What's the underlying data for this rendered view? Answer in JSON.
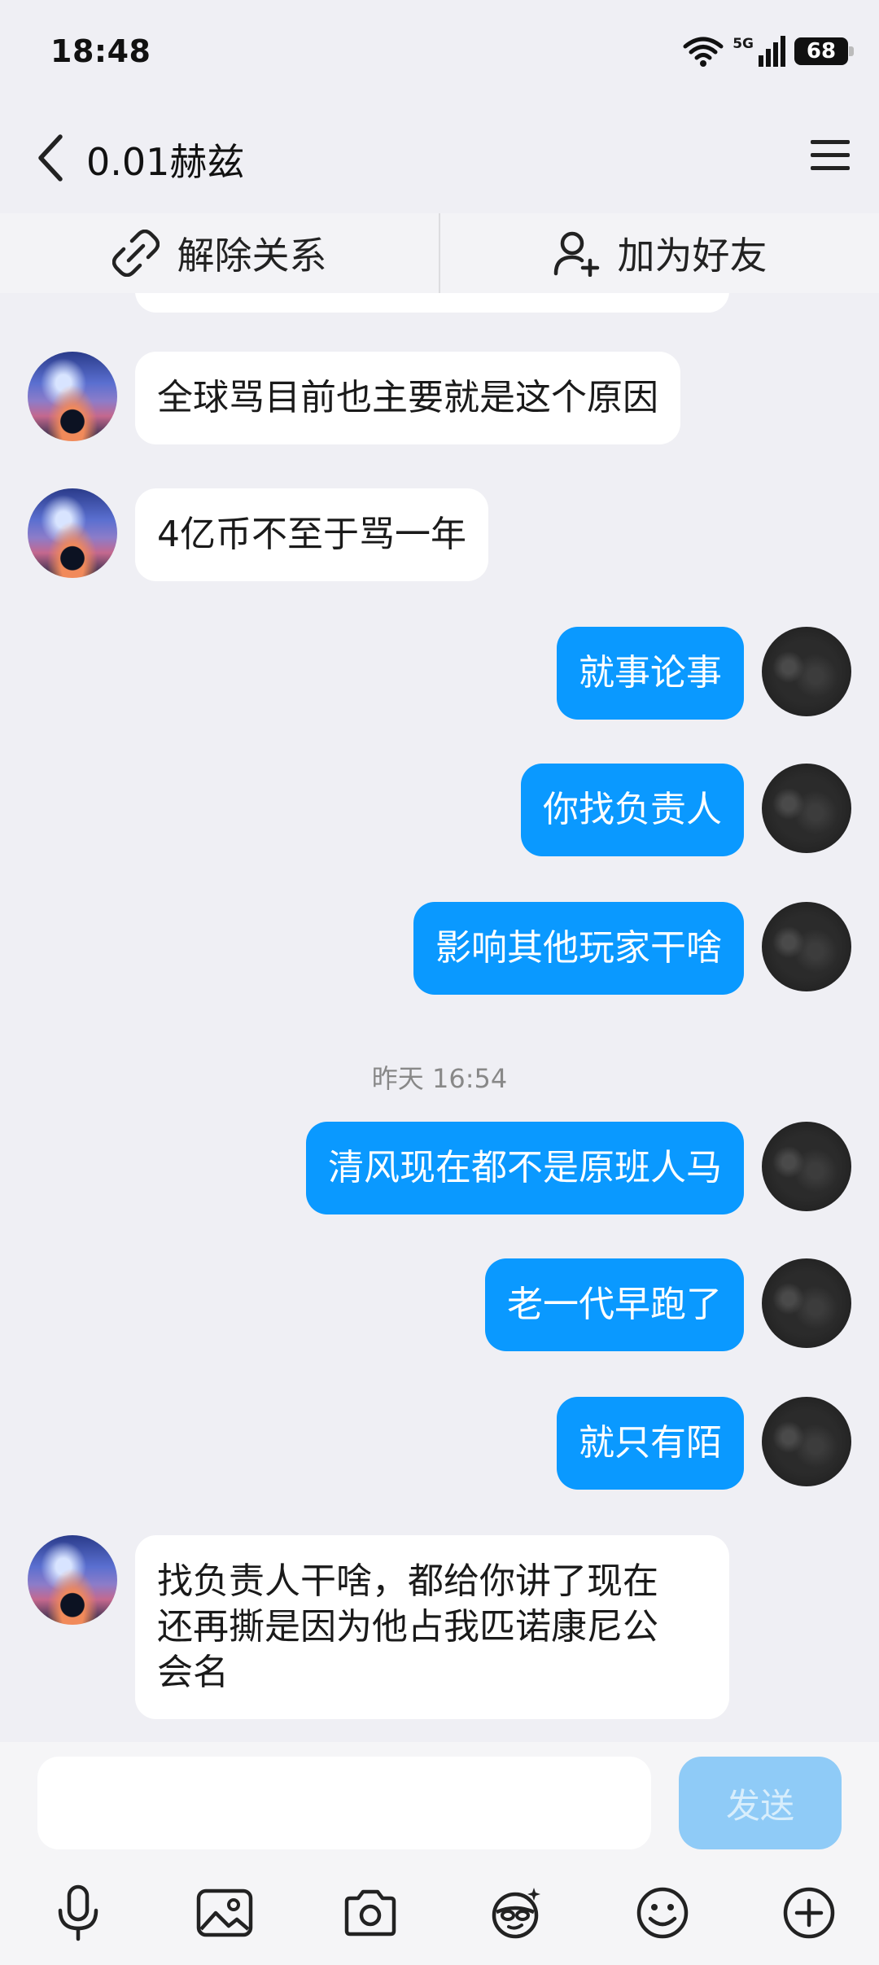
{
  "status_bar": {
    "time": "18:48",
    "network": "5G",
    "battery": "68",
    "battery_level": 68
  },
  "header": {
    "title": "0.01赫兹"
  },
  "actions": {
    "unbind_label": "解除关系",
    "add_friend_label": "加为好友"
  },
  "messages": [
    {
      "side": "them",
      "text": "全球骂目前也主要就是这个原因"
    },
    {
      "side": "them",
      "text": "4亿币不至于骂一年"
    },
    {
      "side": "me",
      "text": "就事论事"
    },
    {
      "side": "me",
      "text": "你找负责人"
    },
    {
      "side": "me",
      "text": "影响其他玩家干啥"
    },
    {
      "side": "me",
      "text": "清风现在都不是原班人马"
    },
    {
      "side": "me",
      "text": "老一代早跑了"
    },
    {
      "side": "me",
      "text": "就只有陌"
    },
    {
      "side": "them",
      "text": "找负责人干啥，都给你讲了现在\n还再撕是因为他占我匹诺康尼公\n会名"
    }
  ],
  "timestamp": "昨天 16:54",
  "input": {
    "value": "",
    "send_label": "发送"
  },
  "toolbar": {
    "icons": [
      "microphone-icon",
      "image-icon",
      "camera-icon",
      "sticker-icon",
      "emoji-icon",
      "plus-icon"
    ]
  },
  "colors": {
    "bubble_me": "#0a99ff",
    "bubble_them": "#ffffff",
    "background": "#efeff4",
    "send_disabled": "#8fcbf7"
  }
}
